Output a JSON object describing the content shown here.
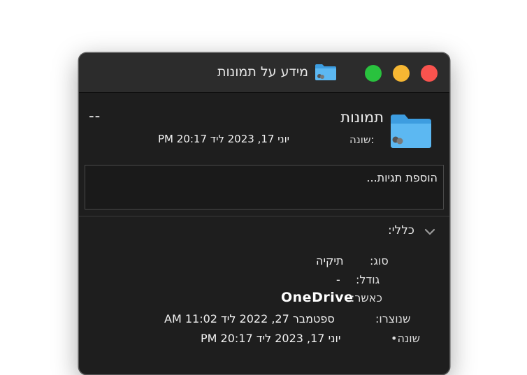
{
  "window": {
    "title": "מידע על תמונות",
    "traffic_lights": {
      "close": "#f9534e",
      "minimize": "#f6b733",
      "zoom": "#29c23e"
    }
  },
  "header": {
    "name": "תמונות",
    "size": "--",
    "modified_label": "שונה:",
    "modified_value": "יוני 17, 2023 ליד 20:17 PM",
    "icon": "folder-icon",
    "folder_color": "#4aa8e8"
  },
  "tags": {
    "placeholder": "הוספת תגיות..."
  },
  "general": {
    "title": "כללי:",
    "chevron": "chevron-down-icon",
    "rows": [
      {
        "label": "סוג:",
        "value": "תיקיה"
      },
      {
        "label": "גודל:",
        "value": "-"
      },
      {
        "label": "כאשר:",
        "value": "OneDrive"
      },
      {
        "label": "שנוצרו:",
        "value": "ספטמבר 27, 2022 ליד 11:02 AM"
      },
      {
        "label": "שונה•",
        "value": "יוני 17, 2023 ליד 20:17 PM"
      }
    ]
  }
}
